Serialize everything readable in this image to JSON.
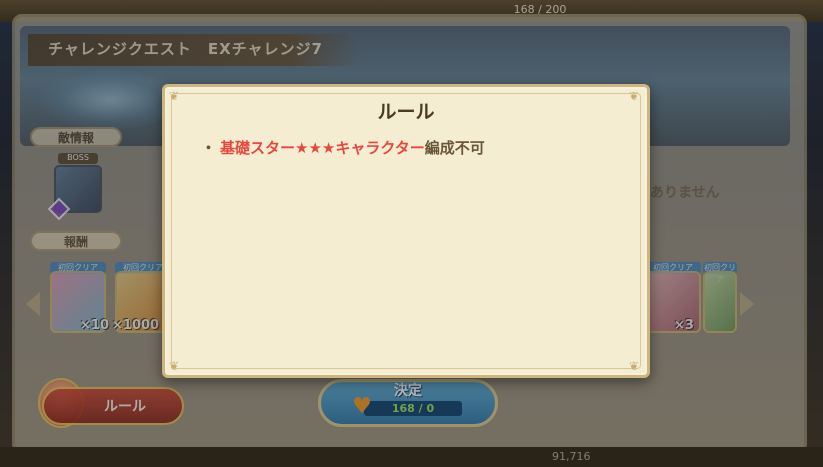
{
  "hud": {
    "stamina_readout": "168 / 200"
  },
  "quest": {
    "title": "チャレンジクエスト　EXチャレンジ7"
  },
  "sections": {
    "enemy_info": "敵情報",
    "boss_badge": "BOSS",
    "rewards": "報酬"
  },
  "rewards": {
    "badge": "初回クリア",
    "items": [
      {
        "count": "×10"
      },
      {
        "count": "×1000"
      },
      {
        "count": "×3"
      }
    ]
  },
  "right_panel": {
    "note": "ありません"
  },
  "buttons": {
    "rule_label": "ルール",
    "confirm_label": "決定",
    "confirm_stamina": "168 / 0"
  },
  "footer": {
    "number": "91,716"
  },
  "dialog": {
    "title": "ルール",
    "rule": {
      "bullet": "・",
      "red_text": "基礎スター★★★キャラクター",
      "normal_text": "編成不可"
    }
  },
  "colors": {
    "dialog_bg": "#f4edd2",
    "dialog_border": "#cdb57f",
    "rule_red": "#e8473e",
    "rule_brown": "#6a5638",
    "confirm_blue": "#2f7fb8"
  }
}
